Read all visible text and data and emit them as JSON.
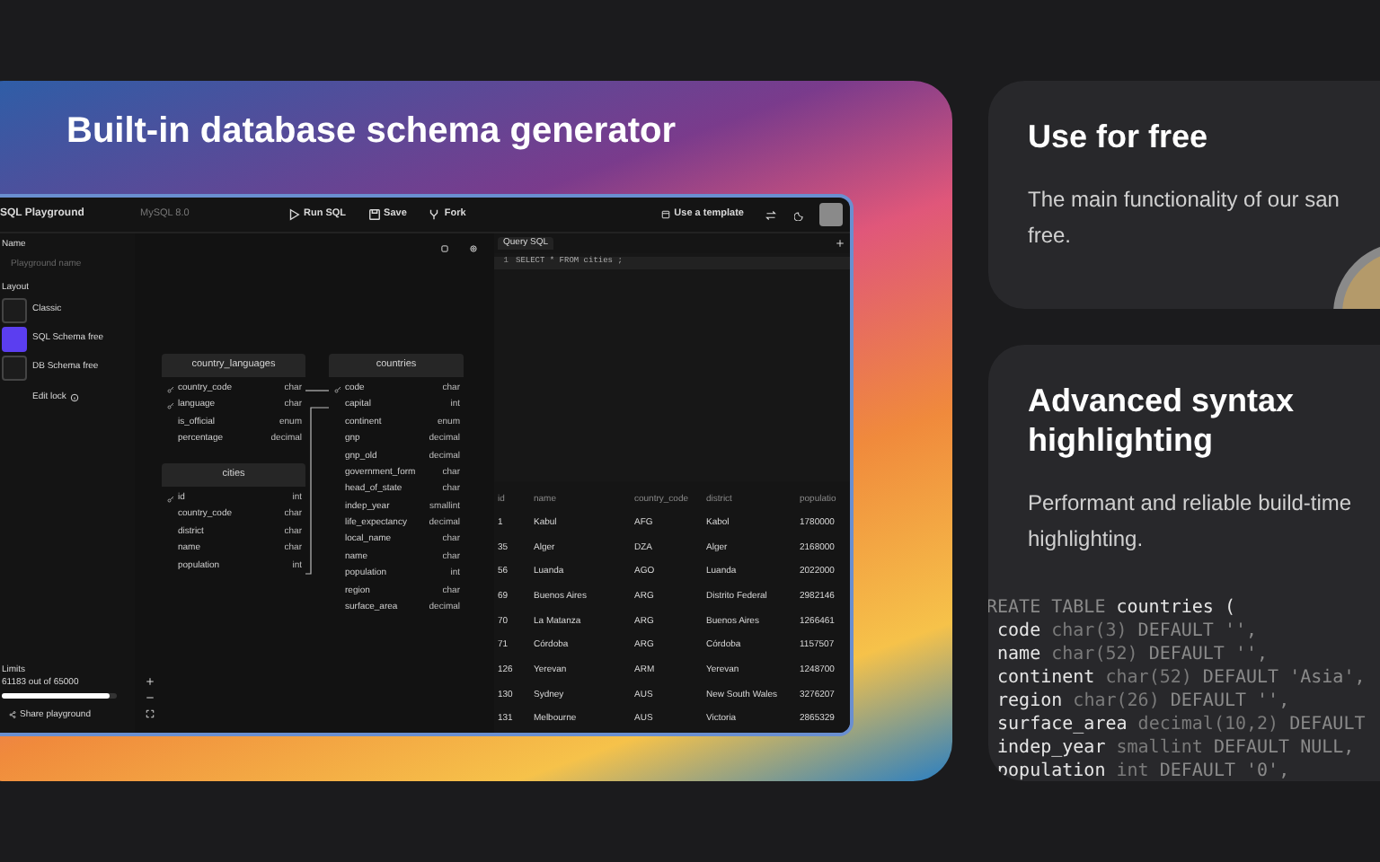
{
  "hero": {
    "title": "Built-in database schema generator"
  },
  "app": {
    "toolbar": {
      "title": "SQL Playground",
      "database": "MySQL 8.0",
      "actions": [
        {
          "kind": "run",
          "label": "Run SQL"
        },
        {
          "kind": "save",
          "label": "Save"
        },
        {
          "kind": "fork",
          "label": "Fork"
        }
      ],
      "template_button": "Use a template"
    },
    "sidebar": {
      "name_label": "Name",
      "name_placeholder": "Playground name",
      "layout_label": "Layout",
      "layouts": [
        {
          "label": "Classic",
          "selected": false
        },
        {
          "label": "SQL Schema free",
          "selected": true
        },
        {
          "label": "DB Schema free",
          "selected": false
        }
      ],
      "edit_lock": "Edit lock",
      "limits_label": "Limits",
      "limits_text": "61183 out of 65000",
      "limits": {
        "level": 0.94
      },
      "share_button": "Share playground"
    },
    "schema": {
      "tables": [
        {
          "name": "country_languages",
          "columns": [
            {
              "name": "country_code",
              "type": "char",
              "key": true
            },
            {
              "name": "language",
              "type": "char",
              "key": true
            },
            {
              "name": "is_official",
              "type": "enum",
              "key": false
            },
            {
              "name": "percentage",
              "type": "decimal",
              "key": false
            }
          ]
        },
        {
          "name": "cities",
          "columns": [
            {
              "name": "id",
              "type": "int",
              "key": true
            },
            {
              "name": "country_code",
              "type": "char",
              "key": false
            },
            {
              "name": "district",
              "type": "char",
              "key": false
            },
            {
              "name": "name",
              "type": "char",
              "key": false
            },
            {
              "name": "population",
              "type": "int",
              "key": false
            }
          ]
        },
        {
          "name": "countries",
          "columns": [
            {
              "name": "code",
              "type": "char",
              "key": true
            },
            {
              "name": "capital",
              "type": "int",
              "key": false
            },
            {
              "name": "continent",
              "type": "enum",
              "key": false
            },
            {
              "name": "gnp",
              "type": "decimal",
              "key": false
            },
            {
              "name": "gnp_old",
              "type": "decimal",
              "key": false
            },
            {
              "name": "government_form",
              "type": "char",
              "key": false
            },
            {
              "name": "head_of_state",
              "type": "char",
              "key": false
            },
            {
              "name": "indep_year",
              "type": "smallint",
              "key": false
            },
            {
              "name": "life_expectancy",
              "type": "decimal",
              "key": false
            },
            {
              "name": "local_name",
              "type": "char",
              "key": false
            },
            {
              "name": "name",
              "type": "char",
              "key": false
            },
            {
              "name": "population",
              "type": "int",
              "key": false
            },
            {
              "name": "region",
              "type": "char",
              "key": false
            },
            {
              "name": "surface_area",
              "type": "decimal",
              "key": false
            }
          ]
        }
      ]
    },
    "editor": {
      "tab": "Query SQL",
      "lines": [
        {
          "number": "1",
          "code": "SELECT * FROM cities ;"
        }
      ]
    },
    "results": {
      "columns": [
        "id",
        "name",
        "country_code",
        "district",
        "populatio"
      ],
      "rows": [
        [
          "1",
          "Kabul",
          "AFG",
          "Kabol",
          "1780000"
        ],
        [
          "35",
          "Alger",
          "DZA",
          "Alger",
          "2168000"
        ],
        [
          "56",
          "Luanda",
          "AGO",
          "Luanda",
          "2022000"
        ],
        [
          "69",
          "Buenos Aires",
          "ARG",
          "Distrito Federal",
          "2982146"
        ],
        [
          "70",
          "La Matanza",
          "ARG",
          "Buenos Aires",
          "1266461"
        ],
        [
          "71",
          "Córdoba",
          "ARG",
          "Córdoba",
          "1157507"
        ],
        [
          "126",
          "Yerevan",
          "ARM",
          "Yerevan",
          "1248700"
        ],
        [
          "130",
          "Sydney",
          "AUS",
          "New South Wales",
          "3276207"
        ],
        [
          "131",
          "Melbourne",
          "AUS",
          "Victoria",
          "2865329"
        ]
      ]
    }
  },
  "features": [
    {
      "title": "Use for free",
      "text_lines": [
        "The main functionality of our san",
        "free."
      ]
    },
    {
      "title": "Advanced syntax highlighting",
      "text_lines": [
        "Performant and reliable build-time",
        "highlighting."
      ],
      "code_lines": [
        [
          {
            "kind": "keyword",
            "text": "REATE TABLE "
          },
          {
            "kind": "name",
            "text": "countries ("
          }
        ],
        [
          {
            "kind": "name",
            "text": " code "
          },
          {
            "kind": "type",
            "text": "char(3) "
          },
          {
            "kind": "keyword",
            "text": "DEFAULT '',"
          }
        ],
        [
          {
            "kind": "name",
            "text": " name "
          },
          {
            "kind": "type",
            "text": "char(52) "
          },
          {
            "kind": "keyword",
            "text": "DEFAULT '',"
          }
        ],
        [
          {
            "kind": "name",
            "text": " continent "
          },
          {
            "kind": "type",
            "text": "char(52) "
          },
          {
            "kind": "keyword",
            "text": "DEFAULT 'Asia',"
          }
        ],
        [
          {
            "kind": "name",
            "text": " region "
          },
          {
            "kind": "type",
            "text": "char(26) "
          },
          {
            "kind": "keyword",
            "text": "DEFAULT '',"
          }
        ],
        [
          {
            "kind": "name",
            "text": " surface_area "
          },
          {
            "kind": "type",
            "text": "decimal(10,2) "
          },
          {
            "kind": "keyword",
            "text": "DEFAULT"
          }
        ],
        [
          {
            "kind": "name",
            "text": " indep_year "
          },
          {
            "kind": "type",
            "text": "smallint "
          },
          {
            "kind": "keyword",
            "text": "DEFAULT NULL,"
          }
        ],
        [
          {
            "kind": "name",
            "text": " population "
          },
          {
            "kind": "type",
            "text": "int "
          },
          {
            "kind": "keyword",
            "text": "DEFAULT '0',"
          }
        ]
      ]
    }
  ]
}
